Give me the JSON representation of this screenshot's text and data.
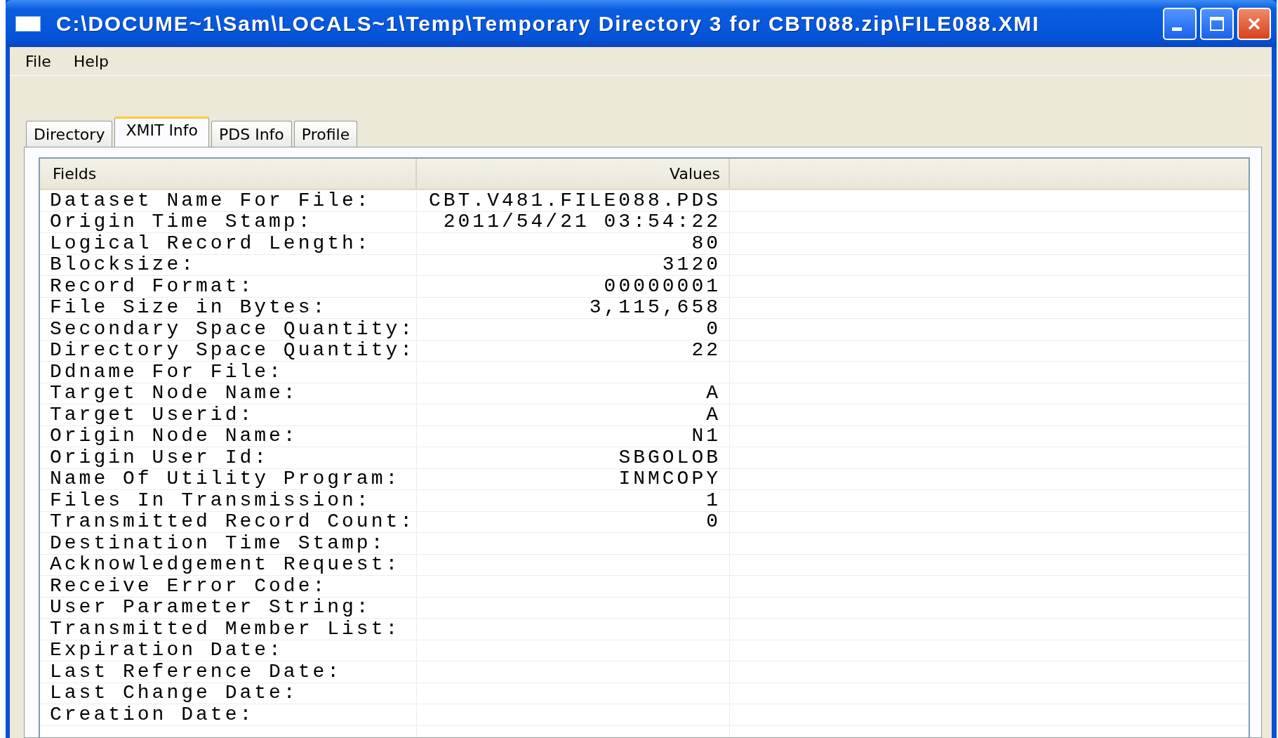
{
  "window": {
    "title": "C:\\DOCUME~1\\Sam\\LOCALS~1\\Temp\\Temporary Directory 3 for CBT088.zip\\FILE088.XMI"
  },
  "menu": [
    "File",
    "Help"
  ],
  "tabs": [
    {
      "label": "Directory",
      "selected": false
    },
    {
      "label": "XMIT Info",
      "selected": true
    },
    {
      "label": "PDS Info",
      "selected": false
    },
    {
      "label": "Profile",
      "selected": false
    }
  ],
  "table": {
    "columns": [
      "Fields",
      "Values"
    ],
    "rows": [
      {
        "field": "Dataset Name For File:",
        "value": "CBT.V481.FILE088.PDS"
      },
      {
        "field": "Origin Time Stamp:",
        "value": "2011/54/21 03:54:22"
      },
      {
        "field": "Logical Record Length:",
        "value": "80"
      },
      {
        "field": "Blocksize:",
        "value": "3120"
      },
      {
        "field": "Record Format:",
        "value": "00000001"
      },
      {
        "field": "File Size in Bytes:",
        "value": "3,115,658"
      },
      {
        "field": "Secondary Space Quantity:",
        "value": "0"
      },
      {
        "field": "Directory Space Quantity:",
        "value": "22"
      },
      {
        "field": "Ddname For File:"
      },
      {
        "field": "Target Node Name:",
        "value": "A"
      },
      {
        "field": "Target Userid:",
        "value": "A"
      },
      {
        "field": "Origin Node Name:",
        "value": "N1"
      },
      {
        "field": "Origin User Id:",
        "value": "SBGOLOB"
      },
      {
        "field": "Name Of Utility Program:",
        "value": "INMCOPY"
      },
      {
        "field": "Files In Transmission:",
        "value": "1"
      },
      {
        "field": "Transmitted Record Count:",
        "value": "0"
      },
      {
        "field": "Destination Time Stamp:"
      },
      {
        "field": "Acknowledgement Request:"
      },
      {
        "field": "Receive Error Code:"
      },
      {
        "field": "User Parameter String:"
      },
      {
        "field": "Transmitted Member List:"
      },
      {
        "field": "Expiration Date:"
      },
      {
        "field": "Last Reference Date:"
      },
      {
        "field": "Last Change Date:"
      },
      {
        "field": "Creation Date:"
      }
    ]
  }
}
